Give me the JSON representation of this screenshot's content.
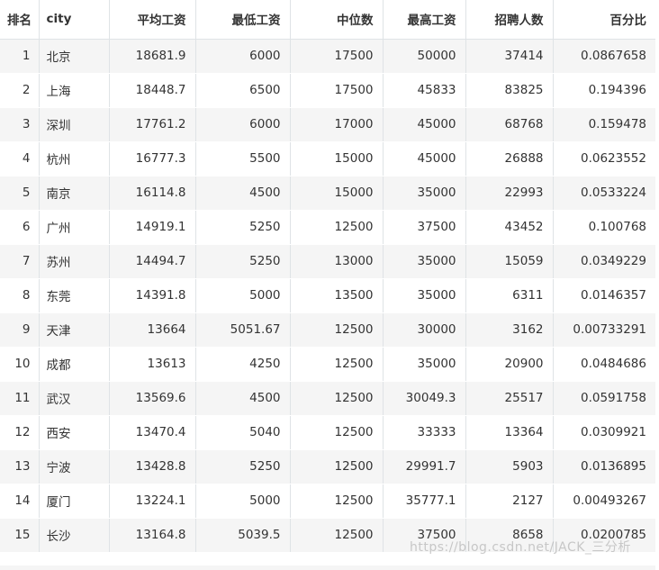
{
  "table": {
    "headers": [
      "排名",
      "city",
      "平均工资",
      "最低工资",
      "中位数",
      "最高工资",
      "招聘人数",
      "百分比"
    ],
    "rows": [
      [
        "1",
        "北京",
        "18681.9",
        "6000",
        "17500",
        "50000",
        "37414",
        "0.0867658"
      ],
      [
        "2",
        "上海",
        "18448.7",
        "6500",
        "17500",
        "45833",
        "83825",
        "0.194396"
      ],
      [
        "3",
        "深圳",
        "17761.2",
        "6000",
        "17000",
        "45000",
        "68768",
        "0.159478"
      ],
      [
        "4",
        "杭州",
        "16777.3",
        "5500",
        "15000",
        "45000",
        "26888",
        "0.0623552"
      ],
      [
        "5",
        "南京",
        "16114.8",
        "4500",
        "15000",
        "35000",
        "22993",
        "0.0533224"
      ],
      [
        "6",
        "广州",
        "14919.1",
        "5250",
        "12500",
        "37500",
        "43452",
        "0.100768"
      ],
      [
        "7",
        "苏州",
        "14494.7",
        "5250",
        "13000",
        "35000",
        "15059",
        "0.0349229"
      ],
      [
        "8",
        "东莞",
        "14391.8",
        "5000",
        "13500",
        "35000",
        "6311",
        "0.0146357"
      ],
      [
        "9",
        "天津",
        "13664",
        "5051.67",
        "12500",
        "30000",
        "3162",
        "0.00733291"
      ],
      [
        "10",
        "成都",
        "13613",
        "4250",
        "12500",
        "35000",
        "20900",
        "0.0484686"
      ],
      [
        "11",
        "武汉",
        "13569.6",
        "4500",
        "12500",
        "30049.3",
        "25517",
        "0.0591758"
      ],
      [
        "12",
        "西安",
        "13470.4",
        "5040",
        "12500",
        "33333",
        "13364",
        "0.0309921"
      ],
      [
        "13",
        "宁波",
        "13428.8",
        "5250",
        "12500",
        "29991.7",
        "5903",
        "0.0136895"
      ],
      [
        "14",
        "厦门",
        "13224.1",
        "5000",
        "12500",
        "35777.1",
        "2127",
        "0.00493267"
      ],
      [
        "15",
        "长沙",
        "13164.8",
        "5039.5",
        "12500",
        "37500",
        "8658",
        "0.0200785"
      ]
    ]
  },
  "watermark": "https://blog.csdn.net/JACK_三分析"
}
